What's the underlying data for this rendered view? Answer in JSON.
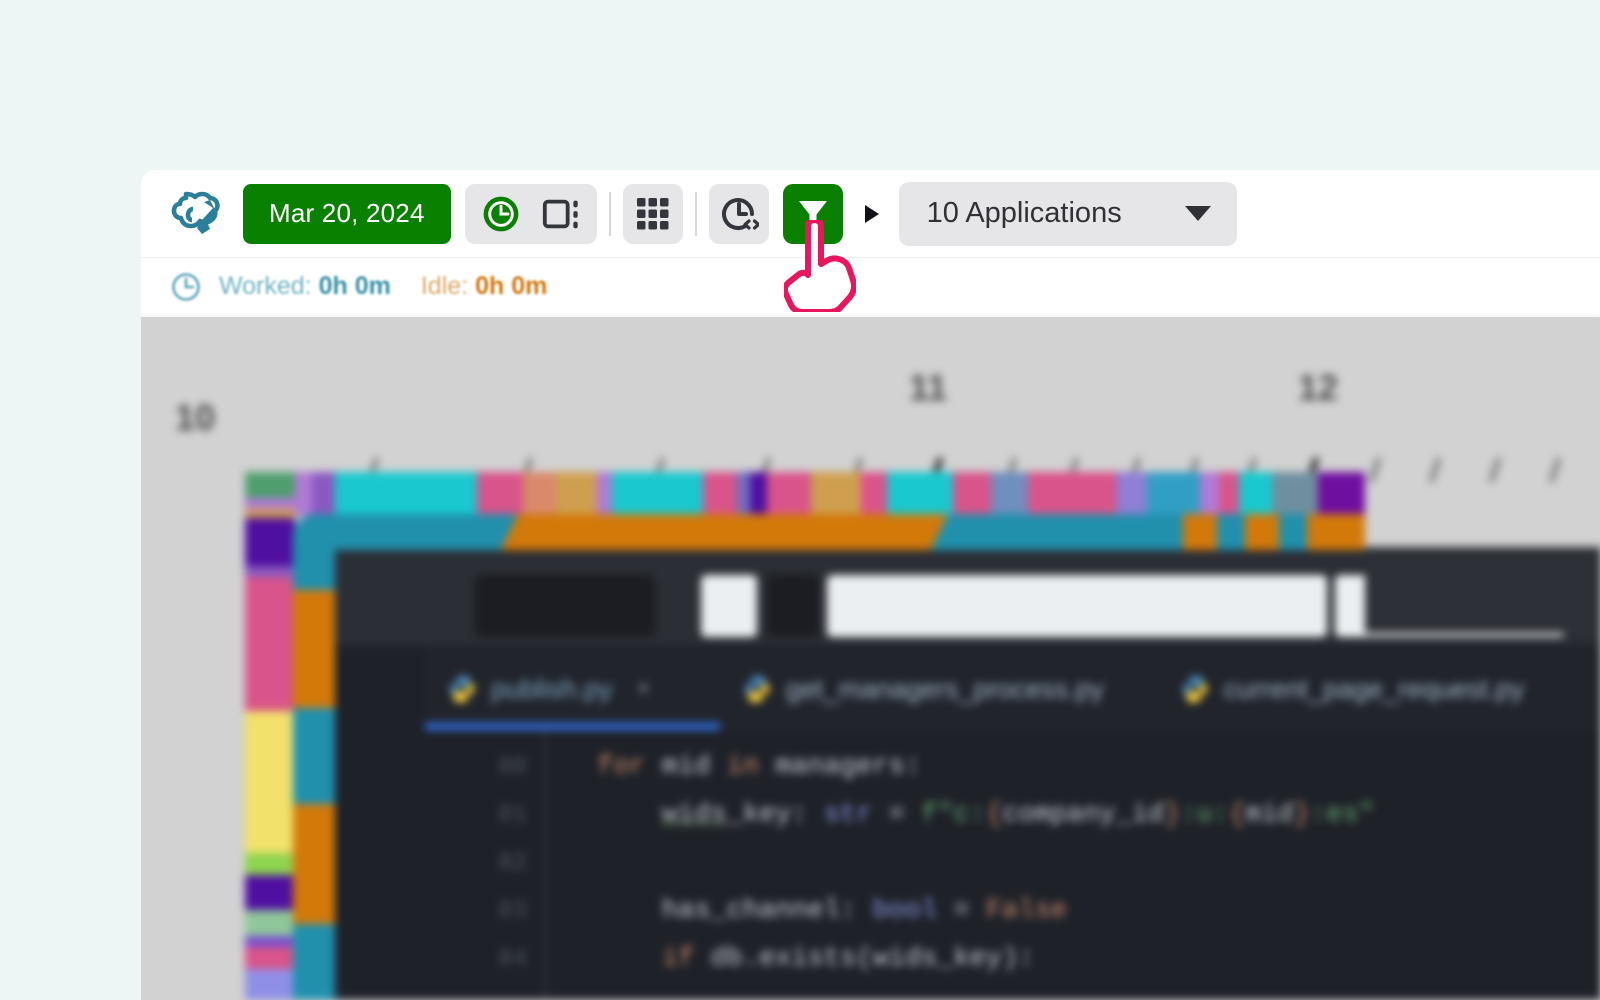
{
  "app": {
    "background_color": "#edf6f4",
    "panel_color": "#ffffff"
  },
  "toolbar": {
    "logo_icon": "cloud-logo-icon",
    "date_button_label": "Mar 20, 2024",
    "accent_green": "#0a8000",
    "buttons": [
      {
        "name": "timer-clock-toggle",
        "icon": "clock-filled-icon",
        "state": "active"
      },
      {
        "name": "panel-layout-toggle",
        "icon": "panel-split-icon",
        "state": "inactive"
      },
      {
        "name": "apps-grid-button",
        "icon": "grid-3x3-icon",
        "state": "inactive"
      },
      {
        "name": "activity-code-button",
        "icon": "clock-code-icon",
        "state": "inactive"
      },
      {
        "name": "filter-button",
        "icon": "funnel-filter-icon",
        "state": "selected"
      }
    ],
    "expand_caret_icon": "caret-right-icon",
    "applications_select": {
      "value": "10 Applications",
      "caret_icon": "caret-down-icon"
    }
  },
  "status_bar": {
    "clock_icon": "clock-outline-icon",
    "worked_label": "Worked:",
    "worked_value": "0h 0m",
    "worked_color": "#3b92a8",
    "idle_label": "Idle:",
    "idle_value": "0h 0m",
    "idle_color": "#cf7a14"
  },
  "timeline": {
    "hour_labels": [
      "10",
      "11",
      "12"
    ],
    "background_color": "#d2d2d2",
    "strip_top_colors": [
      "#4f9e6e",
      "#b07ad6",
      "#8a59c0",
      "#19c9cf",
      "#19c9cf",
      "#19c9cf",
      "#19c9cf",
      "#d9548a",
      "#d98a6a",
      "#cf9f4f",
      "#b07ad6",
      "#19c9cf",
      "#19c9cf",
      "#d9548a",
      "#6f6fbf",
      "#4f0fa0",
      "#d9548a",
      "#cf9f4f",
      "#d9548a",
      "#19c9cf",
      "#19c9cf",
      "#d9548a",
      "#6f8fbf",
      "#d9548a",
      "#d9548a",
      "#8f7fd6",
      "#2f9fc5",
      "#b07ad6",
      "#d9548a",
      "#19c9cf",
      "#6f8f9f",
      "#6f0fa0"
    ],
    "strip_left_colors": [
      "#4f9e6e",
      "#b07ad6",
      "#cf9f4f",
      "#4f0fa0",
      "#8a59c0",
      "#d9548a",
      "#d9548a",
      "#f2e16b",
      "#f2e16b",
      "#8ed44f",
      "#4f0fa0",
      "#8fc79a",
      "#7a4fd0",
      "#d9548a",
      "#8f8fe8"
    ],
    "inner_window_color": "#2090ad",
    "orange_band_color": "#d2790a"
  },
  "editor": {
    "tabs": [
      {
        "filename": "publish.py",
        "icon": "python-file-icon",
        "active": true,
        "closable": true,
        "close_icon": "close-icon"
      },
      {
        "filename": "get_managers_process.py",
        "icon": "python-file-icon",
        "active": false,
        "closable": false
      },
      {
        "filename": "current_page_request.py",
        "icon": "python-file-icon",
        "active": false,
        "closable": false
      }
    ],
    "line_numbers": [
      "80",
      "81",
      "82",
      "83",
      "84"
    ],
    "code_lines": [
      "for mid in managers:",
      "    wids_key: str = f\"c:{company_id}:u:{mid}:es\"",
      "",
      "    has_channel: bool = False",
      "    if db.exists(wids_key):"
    ]
  },
  "cursor": {
    "icon": "pointing-hand-cursor",
    "fill": "#ffffff",
    "stroke": "#e8175d"
  }
}
